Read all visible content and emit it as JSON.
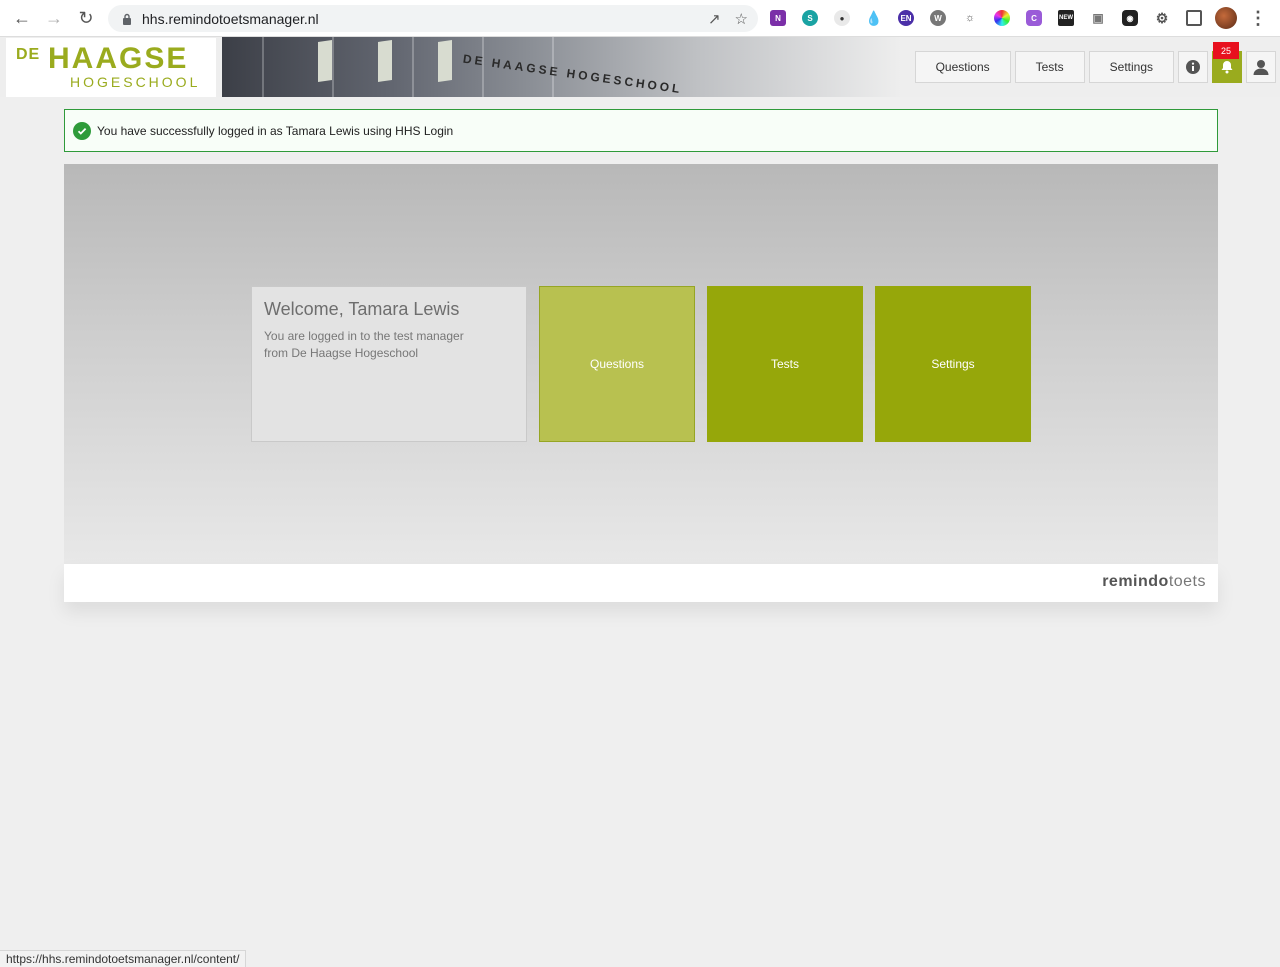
{
  "browser": {
    "url": "hhs.remindotoetsmanager.nl",
    "status_url": "https://hhs.remindotoetsmanager.nl/content/"
  },
  "logo": {
    "de": "DE",
    "haagse": "HAAGSE",
    "hogeschool": "HOGESCHOOL"
  },
  "banner": {
    "sign_text": "DE HAAGSE HOGESCHOOL"
  },
  "nav": {
    "questions": "Questions",
    "tests": "Tests",
    "settings": "Settings",
    "notifications_count": "25"
  },
  "alert": {
    "message": "You have successfully logged in as Tamara Lewis using HHS Login"
  },
  "welcome": {
    "title": "Welcome, Tamara Lewis",
    "subtitle": "You are logged in to the test manager from De Haagse Hogeschool"
  },
  "tiles": {
    "questions": "Questions",
    "tests": "Tests",
    "settings": "Settings"
  },
  "footer": {
    "brand_bold": "remindo",
    "brand_light": "toets"
  },
  "colors": {
    "brand_green": "#9aab1e",
    "tile_light": "#b8c150",
    "tile_dark": "#96a70a",
    "alert_border": "#2f9a3a",
    "badge_red": "#e8101e"
  }
}
